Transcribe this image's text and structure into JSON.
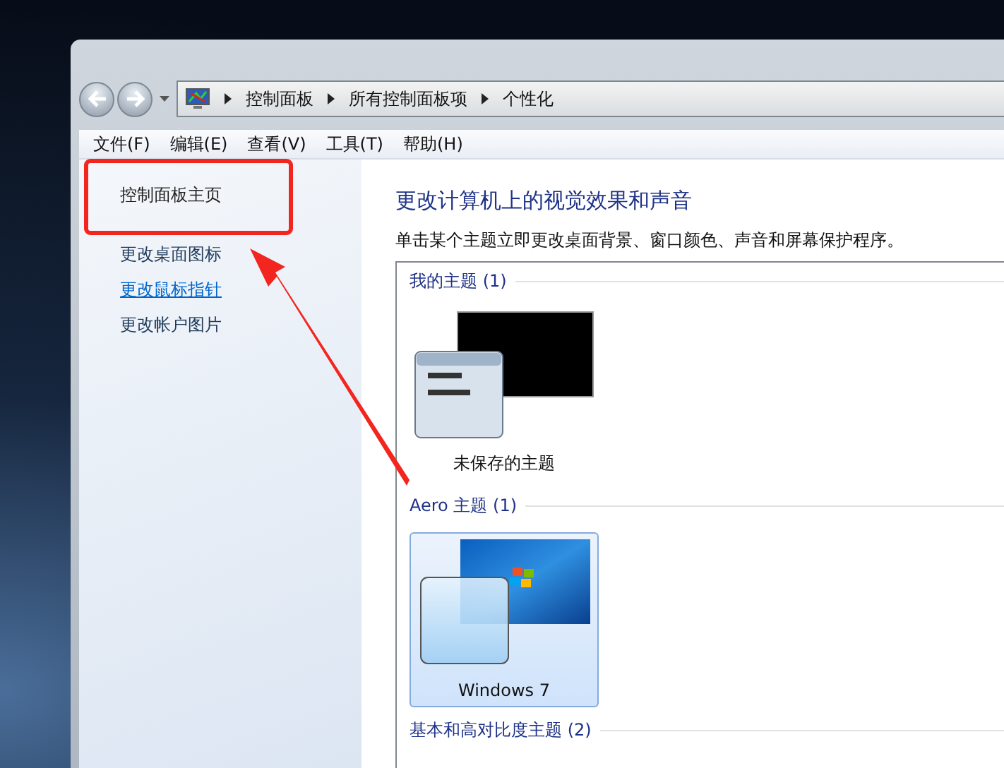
{
  "address_bar": {
    "breadcrumbs": [
      "控制面板",
      "所有控制面板项",
      "个性化"
    ]
  },
  "menu_bar": [
    "文件(F)",
    "编辑(E)",
    "查看(V)",
    "工具(T)",
    "帮助(H)"
  ],
  "sidebar": {
    "items": [
      {
        "label": "控制面板主页",
        "kind": "home",
        "hovered": false
      },
      {
        "label": "更改桌面图标",
        "kind": "link",
        "hovered": false
      },
      {
        "label": "更改鼠标指针",
        "kind": "link",
        "hovered": true
      },
      {
        "label": "更改帐户图片",
        "kind": "link",
        "hovered": false
      }
    ]
  },
  "content": {
    "heading": "更改计算机上的视觉效果和声音",
    "description": "单击某个主题立即更改桌面背景、窗口颜色、声音和屏幕保护程序。",
    "groups": [
      {
        "title": "我的主题 (1)",
        "themes": [
          {
            "name": "未保存的主题",
            "kind": "custom",
            "selected": false
          }
        ]
      },
      {
        "title": "Aero 主题 (1)",
        "themes": [
          {
            "name": "Windows 7",
            "kind": "aero",
            "selected": true
          }
        ]
      },
      {
        "title": "基本和高对比度主题 (2)"
      }
    ]
  }
}
